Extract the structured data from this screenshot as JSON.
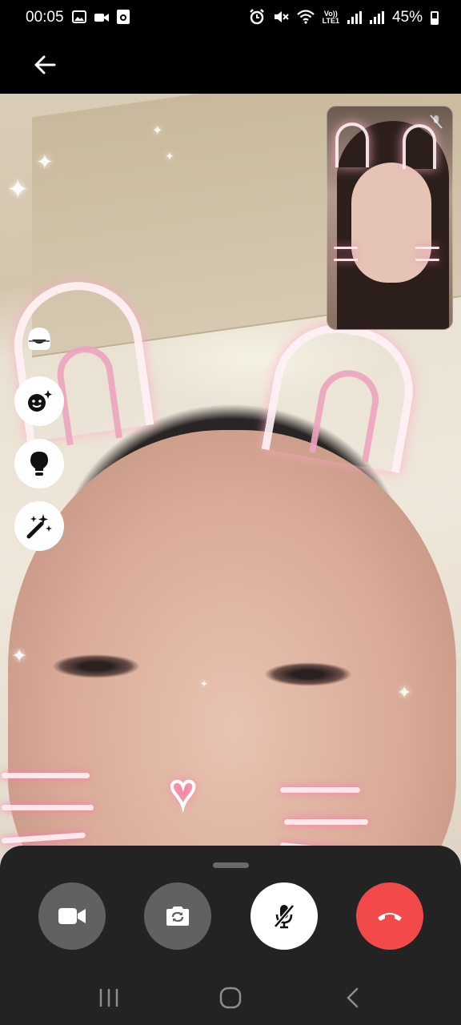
{
  "status_bar": {
    "time": "00:05",
    "left_icons": [
      "gallery-icon",
      "video-camera-icon",
      "camera-app-icon"
    ],
    "right_icons": [
      "alarm-icon",
      "mute-icon",
      "wifi-icon"
    ],
    "network_label_top": "Vo))",
    "network_label_bottom": "LTE1",
    "battery_percent": "45%",
    "battery_level": 0.45
  },
  "top_bar": {
    "back_icon": "arrow-left-icon"
  },
  "video": {
    "remote_filter": "cat ears and whiskers",
    "self_view_icon": "mic-off-small-icon"
  },
  "side_actions": [
    {
      "name": "face-effects-toggle",
      "icon": "face-mask-icon"
    },
    {
      "name": "emoji-effects-button",
      "icon": "smiley-sparkle-icon"
    },
    {
      "name": "light-button",
      "icon": "lightbulb-icon"
    },
    {
      "name": "magic-effects-button",
      "icon": "magic-wand-icon"
    }
  ],
  "controls": [
    {
      "name": "video-toggle",
      "icon": "video-camera-icon",
      "bg": "#616161"
    },
    {
      "name": "flip-camera",
      "icon": "camera-rotate-icon",
      "bg": "#616161"
    },
    {
      "name": "mute-toggle",
      "icon": "mic-off-icon",
      "bg": "#ffffff"
    },
    {
      "name": "end-call",
      "icon": "phone-hangup-icon",
      "bg": "#f24a4a"
    }
  ],
  "nav": [
    "recent-apps-icon",
    "home-icon",
    "back-icon"
  ],
  "colors": {
    "sheet": "#232323",
    "end_call": "#f24a4a",
    "control": "#616161"
  }
}
